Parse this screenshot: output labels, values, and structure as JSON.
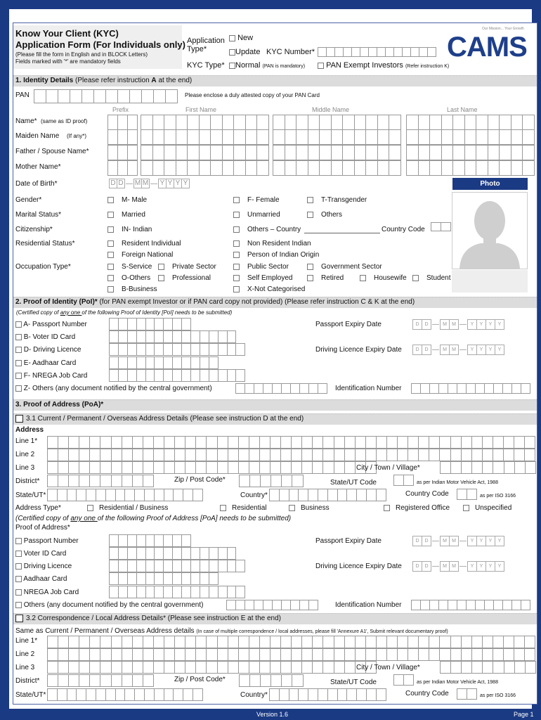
{
  "header": {
    "title_line1": "Know Your Client (KYC)",
    "title_line2": "Application Form (For Individuals only)",
    "note1": "(Please fill the form in English and in BLOCK Letters)",
    "note2": "Fields marked with '*' are mandatory fields",
    "application_type_label1": "Application",
    "application_type_label2": "Type*",
    "option_new": "New",
    "option_update": "Update",
    "kyc_number_label": "KYC Number*",
    "kyc_number_boxes": 14,
    "kyc_type_label": "KYC Type*",
    "option_normal": "Normal",
    "normal_note": "(PAN is mandatory)",
    "option_pan_exempt": "PAN Exempt Investors",
    "pan_exempt_note": "(Refer instruction K)",
    "logo_text": "CAMS",
    "logo_tagline": "Our Mission... Your Growth",
    "brand_color": "#1b3a84"
  },
  "section1": {
    "heading_bold": "1. Identity Details",
    "heading_rest": "(Please refer instruction",
    "heading_letter": "A",
    "heading_end": "at the end)",
    "pan_label": "PAN",
    "pan_boxes": 12,
    "pan_note": "Please enclose a duly attested copy of your PAN Card",
    "col_prefix": "Prefix",
    "col_first": "First Name",
    "col_middle": "Middle Name",
    "col_last": "Last Name",
    "name_rows": [
      {
        "label": "Name*",
        "sub": "(same as ID proof)"
      },
      {
        "label": "Maiden Name",
        "sub": "(If any*)"
      },
      {
        "label": "Father / Spouse Name*",
        "sub": ""
      },
      {
        "label": "Mother Name*",
        "sub": ""
      }
    ],
    "dob_label": "Date of Birth*",
    "date_placeholder": {
      "d": "D",
      "m": "M",
      "y": "Y"
    },
    "photo_label": "Photo",
    "gender_label": "Gender*",
    "gender_options": [
      "M- Male",
      "F- Female",
      "T-Transgender"
    ],
    "marital_label": "Marital Status*",
    "marital_options": [
      "Married",
      "Unmarried",
      "Others"
    ],
    "citizenship_label": "Citizenship*",
    "citizenship_options": [
      "IN- Indian",
      "Others – Country"
    ],
    "country_code_label": "Country Code",
    "residential_label": "Residential Status*",
    "residential_options": [
      "Resident Individual",
      "Non Resident Indian",
      "Foreign National",
      "Person of Indian Origin"
    ],
    "occupation_label": "Occupation Type*",
    "occupation_options": [
      "S-Service",
      "Private Sector",
      "Public Sector",
      "Government Sector",
      "O-Others",
      "Professional",
      "Self Employed",
      "Retired",
      "Housewife",
      "Student",
      "B-Business",
      "X-Not Categorised"
    ]
  },
  "section2": {
    "heading_bold": "2. Proof of Identity (PoI)*",
    "heading_rest": "(for PAN exempt Investor or if PAN card copy not provided) (Please refer instruction C & K at the end)",
    "note_pre": "(Certified copy of ",
    "note_u": "any one ",
    "note_post": "of the following Proof of Identity [PoI] needs to be submitted)",
    "items": [
      {
        "label": "A- Passport Number",
        "boxes": 9
      },
      {
        "label": "B- Voter ID Card",
        "boxes": 14
      },
      {
        "label": "D- Driving Licence",
        "boxes": 15
      },
      {
        "label": "E- Aadhaar Card",
        "boxes": 12
      },
      {
        "label": "F- NREGA Job Card",
        "boxes": 15
      }
    ],
    "others_label": "Z- Others (any document notified by the central government)",
    "others_boxes": 10,
    "passport_expiry_label": "Passport Expiry Date",
    "dl_expiry_label": "Driving Licence Expiry Date",
    "id_number_label": "Identification Number",
    "id_number_boxes": 13
  },
  "section3": {
    "heading": "3. Proof of Address (PoA)*",
    "sub31": "3.1 Current / Permanent / Overseas Address Details (Please see instruction D at the end)",
    "address_label": "Address",
    "line1": "Line 1*",
    "line2": "Line 2",
    "line3": "Line 3",
    "city_label": "City / Town / Village*",
    "district_label": "District*",
    "zip_label": "Zip / Post Code*",
    "state_code_label": "State/UT Code",
    "state_code_note": "as per Indian Motor Vehicle Act, 1988",
    "state_label": "State/UT*",
    "country_label": "Country*",
    "country_code_label": "Country Code",
    "country_code_note": "as per ISO 3166",
    "address_type_label": "Address Type*",
    "address_types": [
      "Residential / Business",
      "Residential",
      "Business",
      "Registered Office",
      "Unspecified"
    ],
    "poa_note_pre": "(Certified copy of ",
    "poa_note_u": "any one ",
    "poa_note_post": "of the following Proof of Address [PoA] needs to be submitted)",
    "poa_label": "Proof of Address*",
    "poa_items": [
      {
        "label": "Passport Number",
        "boxes": 9
      },
      {
        "label": "Voter ID Card",
        "boxes": 14
      },
      {
        "label": "Driving Licence",
        "boxes": 15
      },
      {
        "label": "Aadhaar Card",
        "boxes": 12
      },
      {
        "label": "NREGA Job Card",
        "boxes": 15
      }
    ],
    "poa_others_label": "Others (any document notified by the central government)",
    "poa_others_boxes": 10,
    "passport_expiry_label": "Passport Expiry Date",
    "dl_expiry_label": "Driving Licence Expiry Date",
    "id_number_label": "Identification Number",
    "sub32": "3.2 Correspondence / Local Address Details* (Please see instruction E at the end)",
    "same_as_label": "Same as Current / Permanent / Overseas Address details",
    "same_as_note": "(In case of multiple correspondence / local addresses, please fill 'Annexure A1', Submit relevant documentary proof)"
  },
  "footer": {
    "version": "Version 1.6",
    "page": "Page 1"
  }
}
